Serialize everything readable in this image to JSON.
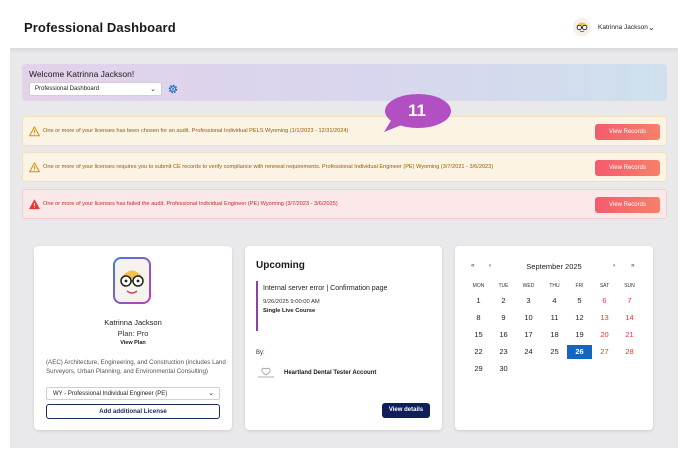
{
  "header": {
    "title": "Professional Dashboard",
    "user_name": "Katrinna Jackson"
  },
  "welcome": {
    "greeting": "Welcome Katrinna Jackson!",
    "dashboard_select": "Professional Dashboard"
  },
  "badge": {
    "count": "11"
  },
  "alerts": [
    {
      "type": "warning",
      "text": "One or more of your licenses has been chosen for an audit.  Professional Individual PELS Wyoming (1/1/2023 - 12/31/2024)",
      "button": "View Records"
    },
    {
      "type": "warning",
      "text": "One or more of your licenses requires you to submit CE records to verify compliance with renewal requirements.  Professional Individual Engineer (PE) Wyoming (3/7/2021 - 3/6/2023)",
      "button": "View Records"
    },
    {
      "type": "error",
      "text": "One or more of your licenses has failed the audit.  Professional Individual Engineer (PE) Wyoming (3/7/2023 - 3/6/2025)",
      "button": "View Records"
    }
  ],
  "profile": {
    "name": "Katrinna Jackson",
    "plan": "Plan: Pro",
    "view_plan": "View Plan",
    "description": "(AEC) Architecture, Engineering, and Construction (includes Land Surveyors, Urban Planning, and Environmental Consulting)",
    "license_select": "WY - Professional Individual Engineer (PE)",
    "add_license": "Add additional License"
  },
  "upcoming": {
    "heading": "Upcoming",
    "event": {
      "title": "Internal server error | Confirmation page",
      "datetime": "9/26/2025 9:00:00 AM",
      "type": "Single Live Course"
    },
    "by_label": "By:",
    "provider": "Heartland Dental Tester Account",
    "button": "View details"
  },
  "calendar": {
    "title": "September 2025",
    "prev_year": "«",
    "prev_month": "‹",
    "next_month": "›",
    "next_year": "»",
    "weekdays": [
      "MON",
      "TUE",
      "WED",
      "THU",
      "FRI",
      "SAT",
      "SUN"
    ],
    "weeks": [
      [
        "1",
        "2",
        "3",
        "4",
        "5",
        "6",
        "7"
      ],
      [
        "8",
        "9",
        "10",
        "11",
        "12",
        "13",
        "14"
      ],
      [
        "15",
        "16",
        "17",
        "18",
        "19",
        "20",
        "21"
      ],
      [
        "22",
        "23",
        "24",
        "25",
        "26",
        "27",
        "28"
      ],
      [
        "29",
        "30",
        "",
        "",
        "",
        "",
        ""
      ]
    ],
    "today": "26",
    "colors": {
      "weekend": "#e53935",
      "today": "#1565c0"
    }
  },
  "colors": {
    "alert_button": "#f45b6e",
    "badge": "#b24fc2",
    "primary_button": "#0f1f5c"
  }
}
